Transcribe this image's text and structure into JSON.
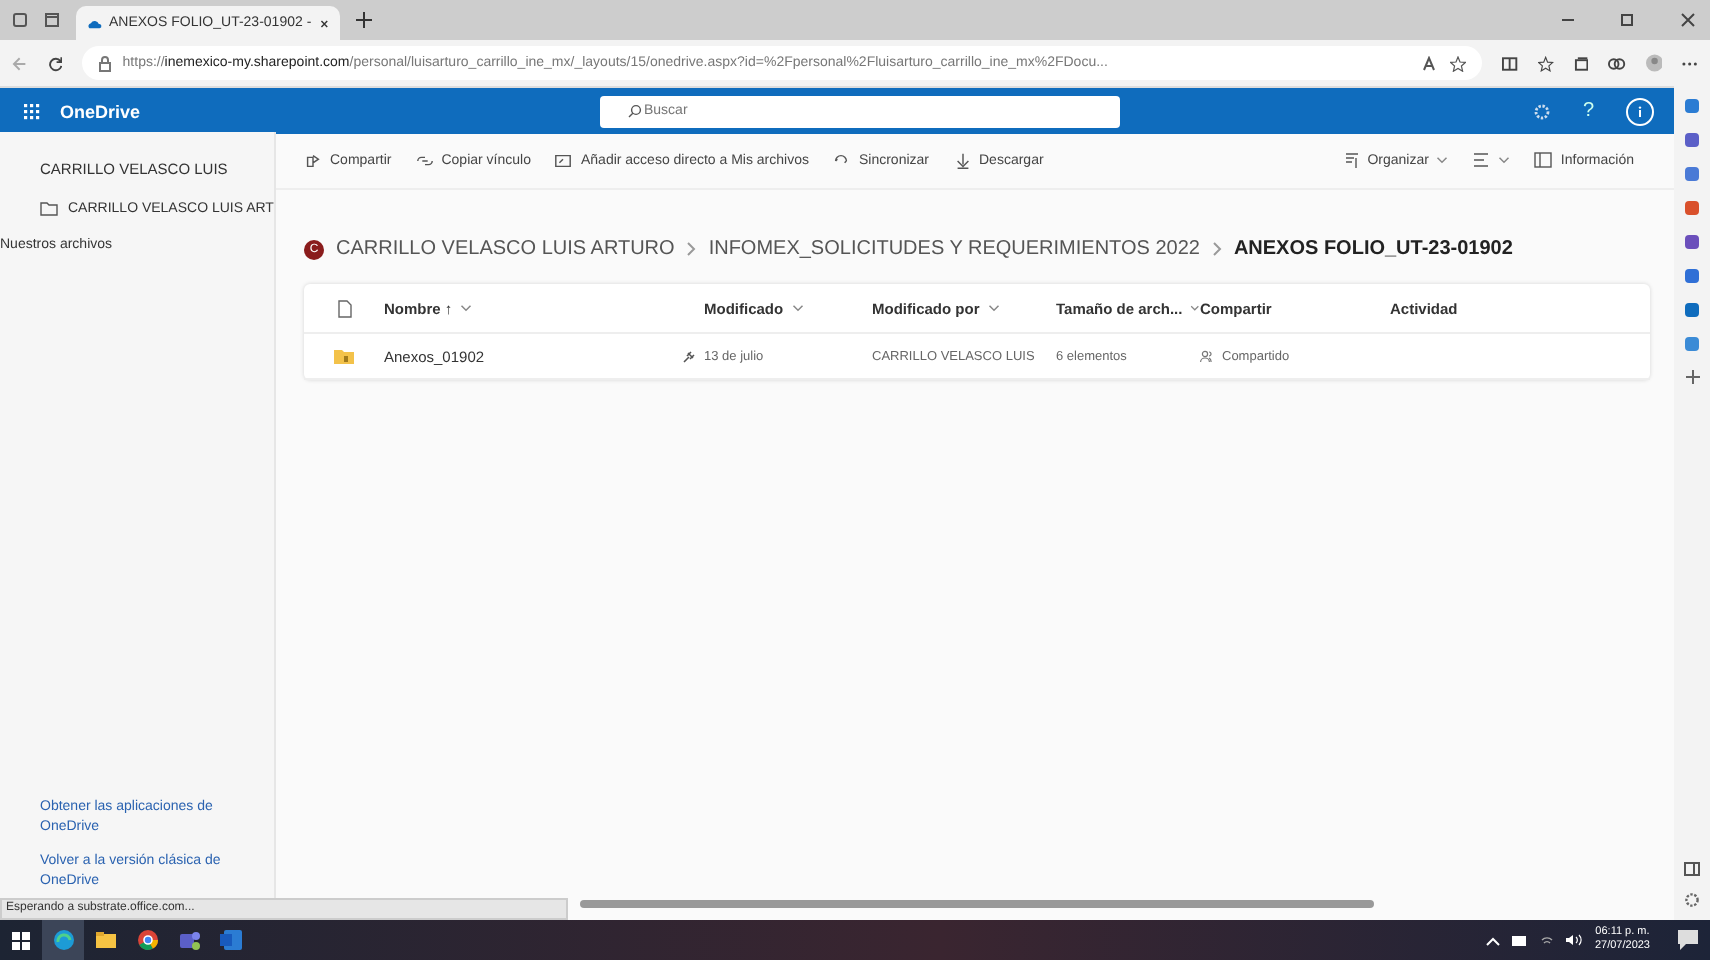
{
  "browser": {
    "tab_title": "ANEXOS FOLIO_UT-23-01902 -",
    "url": "https://**inemexico-my.sharepoint.com**/personal/luisarturo_carrillo_ine_mx/_layouts/15/onedrive.aspx?id=%2Fpersonal%2Fluisarturo_carrillo_ine_mx%2FDocu..."
  },
  "app_header": {
    "title": "OneDrive",
    "search": {
      "placeholder": "Buscar"
    },
    "help": "?"
  },
  "sidebar": {
    "heading": "CARRILLO VELASCO LUIS",
    "items": [
      {
        "label": "CARRILLO VELASCO LUIS ART",
        "kind": "folder"
      },
      {
        "label": "Nuestros archivos",
        "kind": "plain"
      }
    ],
    "footer_links": [
      "Obtener las aplicaciones de OneDrive",
      "Volver a la versión clásica de OneDrive"
    ]
  },
  "command_bar": {
    "left": [
      "Compartir",
      "Copiar vínculo",
      "Añadir acceso directo a Mis archivos",
      "Sincronizar",
      "Descargar"
    ],
    "right": [
      "Organizar",
      "Información"
    ]
  },
  "breadcrumb": {
    "avatar": "C",
    "items": [
      "CARRILLO VELASCO LUIS ARTURO",
      "INFOMEX_SOLICITUDES Y REQUERIMIENTOS 2022",
      "ANEXOS FOLIO_UT-23-01902"
    ]
  },
  "table": {
    "columns": [
      "Nombre ↑",
      "Modificado",
      "Modificado por",
      "Tamaño de arch...",
      "Compartir",
      "Actividad"
    ],
    "rows": [
      {
        "name": "Anexos_01902",
        "modified": "13 de julio",
        "modified_by": "CARRILLO VELASCO LUIS",
        "size": "6 elementos",
        "sharing": "Compartido",
        "selected": false
      }
    ]
  },
  "status_bar": "Esperando a substrate.office.com...",
  "taskbar": {
    "apps": [
      {
        "kind": "edge",
        "selected": true
      },
      {
        "kind": "explorer",
        "selected": false
      },
      {
        "kind": "chrome",
        "selected": false
      },
      {
        "kind": "teams",
        "selected": false
      },
      {
        "kind": "word",
        "selected": false
      }
    ],
    "time": "06:11 p. m.",
    "date": "27/07/2023"
  }
}
